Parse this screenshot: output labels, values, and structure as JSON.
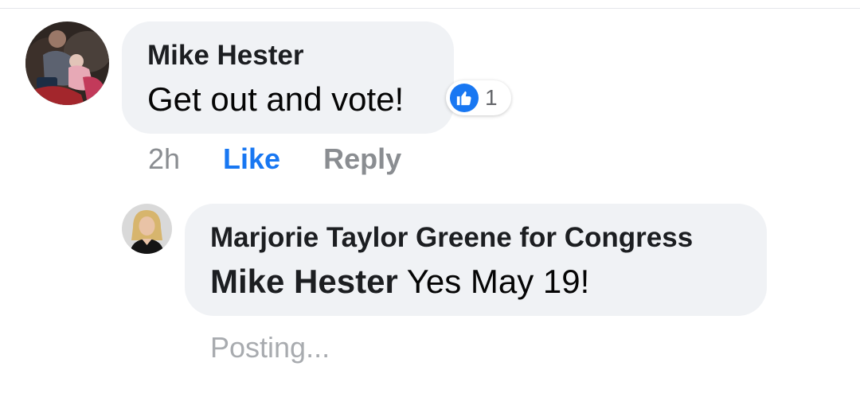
{
  "comment": {
    "author": "Mike Hester",
    "text": "Get out and vote!",
    "avatar_icon": "user-photo-avatar",
    "reactions": {
      "icon": "thumbs-up-icon",
      "count": "1",
      "color": "#1877f2"
    },
    "actions": {
      "timestamp": "2h",
      "like_label": "Like",
      "reply_label": "Reply"
    }
  },
  "reply": {
    "author": "Marjorie Taylor Greene for Congress",
    "mention": "Mike Hester",
    "text": "Yes May 19!",
    "avatar_icon": "page-profile-avatar",
    "status": "Posting..."
  },
  "colors": {
    "bubble": "#f0f2f5",
    "accent": "#1877f2",
    "muted": "#8a8d91"
  }
}
